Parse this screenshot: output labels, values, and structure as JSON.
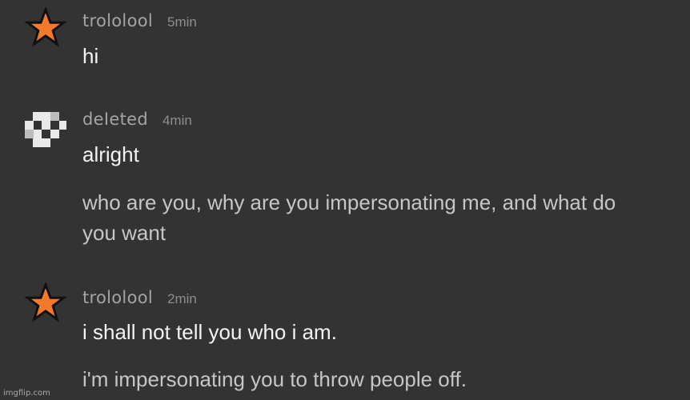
{
  "messages": [
    {
      "username": "trololool",
      "time": "5min",
      "avatar": "orange-star-icon",
      "lines": [
        "hi"
      ]
    },
    {
      "username": "deIeted",
      "time": "4min",
      "avatar": "pixel-checker-icon",
      "lines": [
        "alright",
        "who are you, why are you impersonating me, and what do you want"
      ]
    },
    {
      "username": "trololool",
      "time": "2min",
      "avatar": "orange-star-icon",
      "lines": [
        "i shall not tell you who i am.",
        "i'm impersonating you to throw people off."
      ]
    }
  ],
  "watermark": "imgflip.com",
  "colors": {
    "background": "#333333",
    "star_fill": "#f47a2a",
    "star_stroke": "#111111",
    "username": "#a4a4a4",
    "timestamp": "#8e8e8e",
    "message_text": "#f3f3f3"
  }
}
